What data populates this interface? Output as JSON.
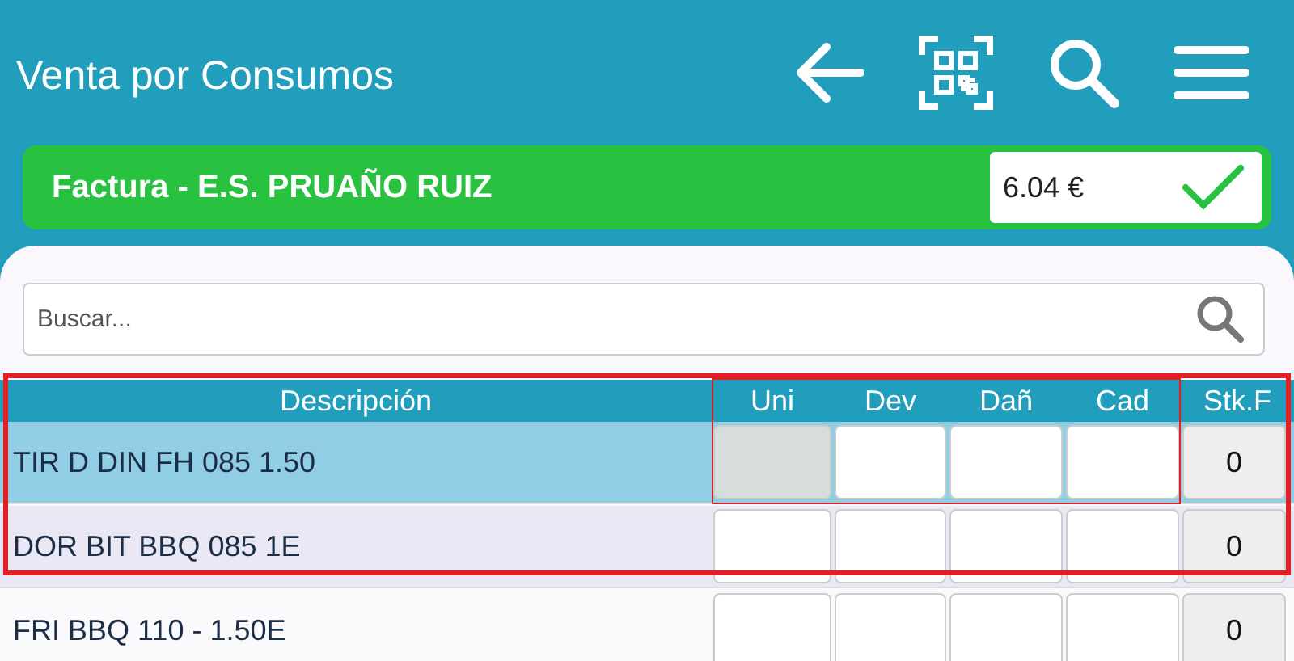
{
  "app_bar": {
    "title": "Venta por Consumos"
  },
  "invoice": {
    "label": "Factura - E.S. PRUAÑO RUIZ",
    "amount": "6.04 €"
  },
  "search": {
    "placeholder": "Buscar..."
  },
  "table": {
    "columns": [
      "Descripción",
      "Uni",
      "Dev",
      "Dañ",
      "Cad",
      "Stk.F"
    ],
    "rows": [
      {
        "description": "TIR D DIN FH 085 1.50",
        "selected": true,
        "uni_disabled": true,
        "stock": "0"
      },
      {
        "description": "DOR BIT BBQ 085 1E",
        "selected": false,
        "uni_disabled": false,
        "stock": "0"
      },
      {
        "description": "FRI BBQ 110 - 1.50E",
        "selected": false,
        "uni_disabled": false,
        "stock": "0"
      }
    ]
  }
}
